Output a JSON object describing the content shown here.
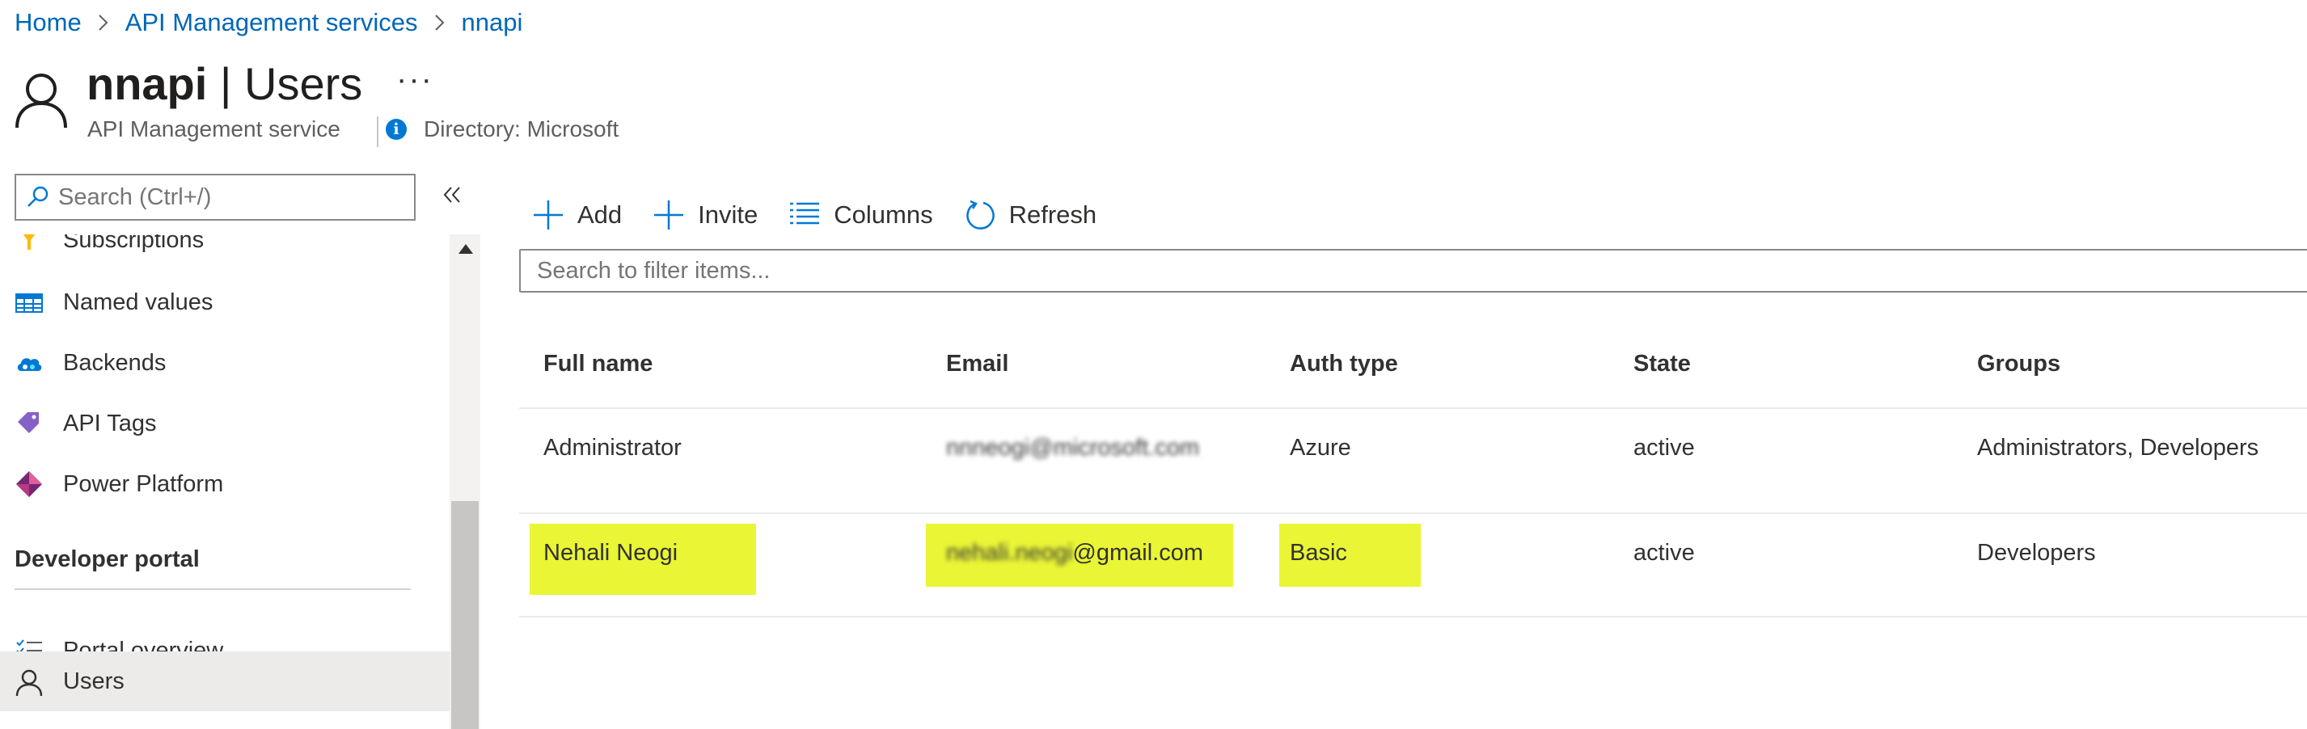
{
  "breadcrumb": {
    "items": [
      "Home",
      "API Management services",
      "nnapi"
    ]
  },
  "header": {
    "resource_name": "nnapi",
    "separator": " | ",
    "page_name": "Users",
    "more_label": "···",
    "subtitle": "API Management service",
    "directory": "Directory: Microsoft"
  },
  "sidebar": {
    "search_placeholder": "Search (Ctrl+/)",
    "items": [
      {
        "label": "Subscriptions",
        "icon": "key-icon"
      },
      {
        "label": "Named values",
        "icon": "table-icon"
      },
      {
        "label": "Backends",
        "icon": "cloud-icon"
      },
      {
        "label": "API Tags",
        "icon": "tag-icon"
      },
      {
        "label": "Power Platform",
        "icon": "power-platform-icon"
      }
    ],
    "section_title": "Developer portal",
    "section_items": [
      {
        "label": "Portal overview",
        "icon": "checklist-icon",
        "selected": false
      },
      {
        "label": "Users",
        "icon": "user-icon",
        "selected": true
      }
    ]
  },
  "toolbar": {
    "add_label": "Add",
    "invite_label": "Invite",
    "columns_label": "Columns",
    "refresh_label": "Refresh"
  },
  "filter": {
    "placeholder": "Search to filter items..."
  },
  "table": {
    "columns": [
      "Full name",
      "Email",
      "Auth type",
      "State",
      "Groups"
    ],
    "rows": [
      {
        "full_name": "Administrator",
        "email_hidden": "nnneogi@microsoft.com",
        "email_domain": "",
        "auth_type": "Azure",
        "state": "active",
        "groups": "Administrators, Developers",
        "highlighted": false
      },
      {
        "full_name": "Nehali Neogi",
        "email_hidden": "nehali.neogi",
        "email_domain": "@gmail.com",
        "auth_type": "Basic",
        "state": "active",
        "groups": "Developers",
        "highlighted": true
      }
    ]
  },
  "colors": {
    "link": "#0067b8",
    "accent": "#0078d4",
    "highlight": "#e9f535",
    "selected_bg": "#edebe9"
  }
}
